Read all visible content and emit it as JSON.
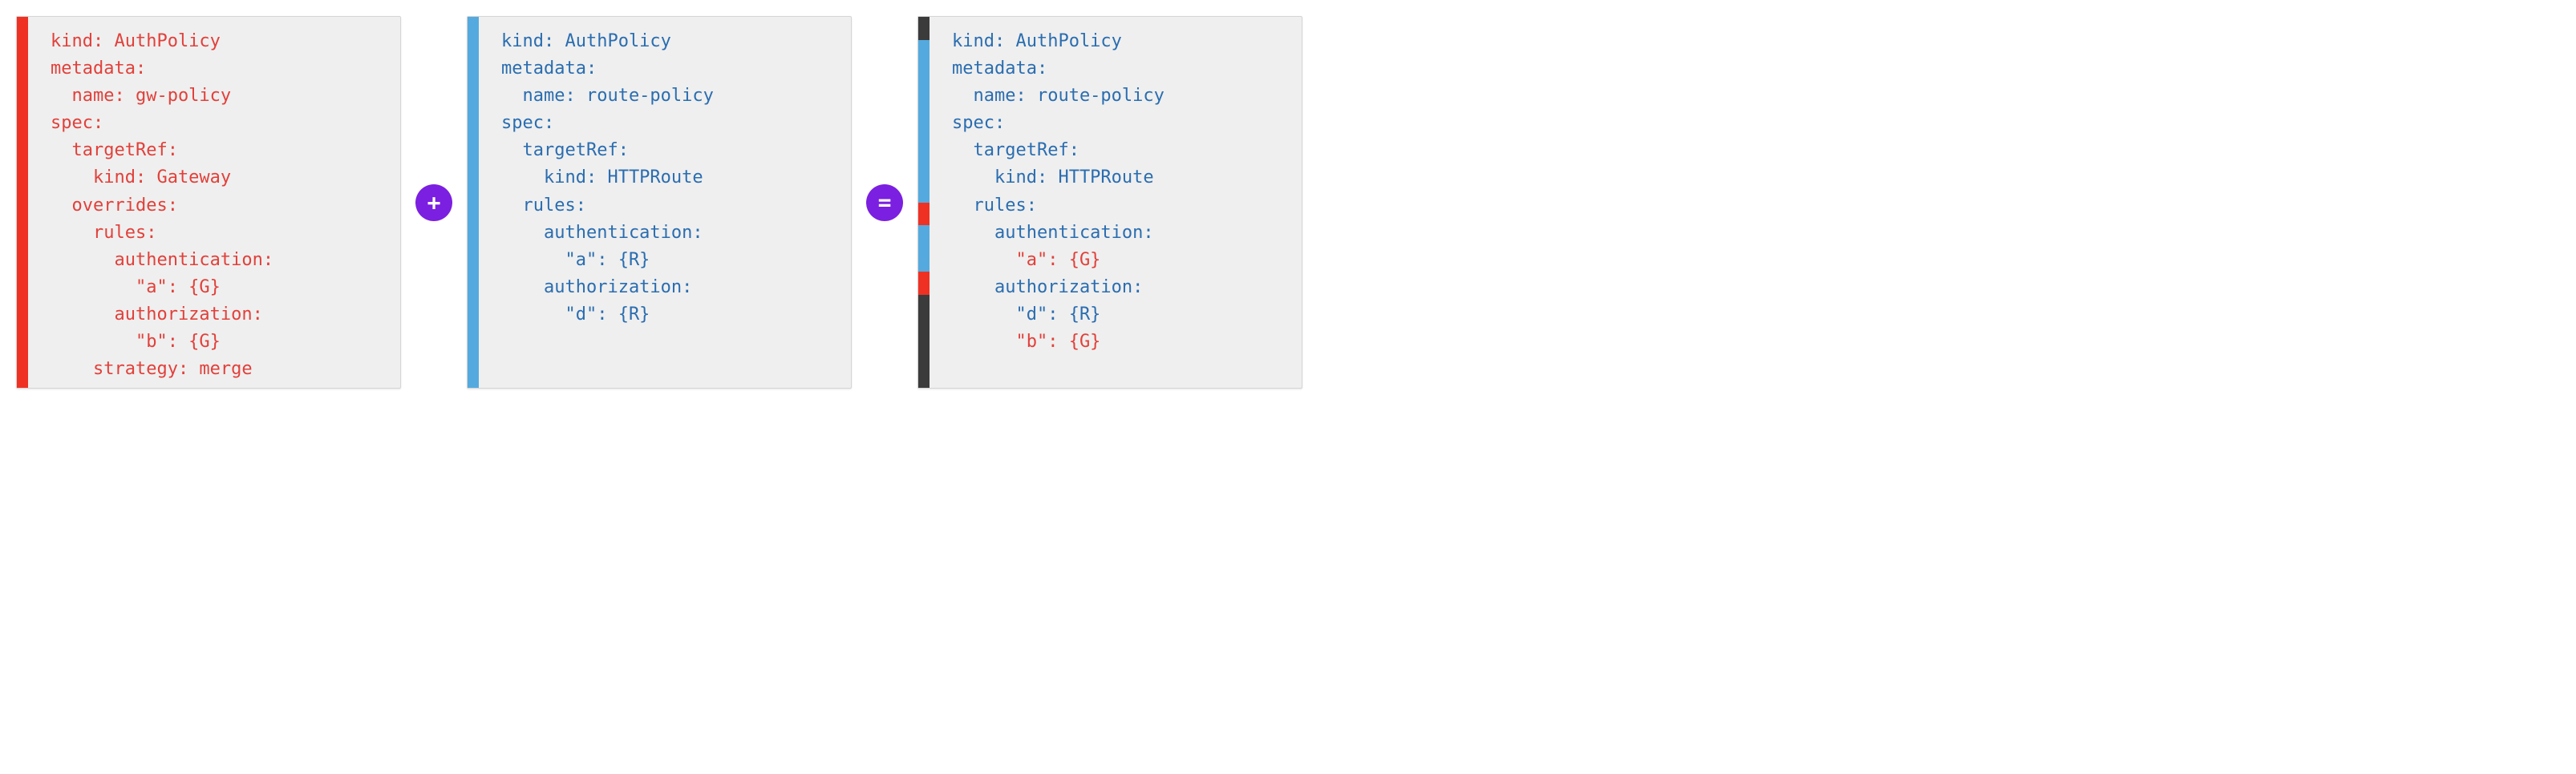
{
  "operators": {
    "plus": "+",
    "equals": "="
  },
  "panels": [
    {
      "gutter": [
        {
          "color": "#ef3123",
          "flex": 1
        }
      ],
      "lines": [
        {
          "cls": "red",
          "indent": 0,
          "text": "kind: AuthPolicy"
        },
        {
          "cls": "red",
          "indent": 0,
          "text": "metadata:"
        },
        {
          "cls": "red",
          "indent": 1,
          "text": "name: gw-policy"
        },
        {
          "cls": "red",
          "indent": 0,
          "text": "spec:"
        },
        {
          "cls": "red",
          "indent": 1,
          "text": "targetRef:"
        },
        {
          "cls": "red",
          "indent": 2,
          "text": "kind: Gateway"
        },
        {
          "cls": "red",
          "indent": 1,
          "text": "overrides:"
        },
        {
          "cls": "red",
          "indent": 2,
          "text": "rules:"
        },
        {
          "cls": "red",
          "indent": 3,
          "text": "authentication:"
        },
        {
          "cls": "red",
          "indent": 4,
          "text": "\"a\": {G}"
        },
        {
          "cls": "red",
          "indent": 3,
          "text": "authorization:"
        },
        {
          "cls": "red",
          "indent": 4,
          "text": "\"b\": {G}"
        },
        {
          "cls": "red",
          "indent": 2,
          "text": "strategy: merge"
        }
      ]
    },
    {
      "gutter": [
        {
          "color": "#54aade",
          "flex": 1
        }
      ],
      "lines": [
        {
          "cls": "blue",
          "indent": 0,
          "text": "kind: AuthPolicy"
        },
        {
          "cls": "blue",
          "indent": 0,
          "text": "metadata:"
        },
        {
          "cls": "blue",
          "indent": 1,
          "text": "name: route-policy"
        },
        {
          "cls": "blue",
          "indent": 0,
          "text": "spec:"
        },
        {
          "cls": "blue",
          "indent": 1,
          "text": "targetRef:"
        },
        {
          "cls": "blue",
          "indent": 2,
          "text": "kind: HTTPRoute"
        },
        {
          "cls": "blue",
          "indent": 1,
          "text": "rules:"
        },
        {
          "cls": "blue",
          "indent": 2,
          "text": "authentication:"
        },
        {
          "cls": "blue",
          "indent": 3,
          "text": "\"a\": {R}"
        },
        {
          "cls": "blue",
          "indent": 2,
          "text": "authorization:"
        },
        {
          "cls": "blue",
          "indent": 3,
          "text": "\"d\": {R}"
        }
      ]
    },
    {
      "gutter": [
        {
          "color": "#3b3b3b",
          "flex": 1
        },
        {
          "color": "#54aade",
          "flex": 7
        },
        {
          "color": "#ef3123",
          "flex": 1
        },
        {
          "color": "#54aade",
          "flex": 2
        },
        {
          "color": "#ef3123",
          "flex": 1
        },
        {
          "color": "#3b3b3b",
          "flex": 4
        }
      ],
      "lines": [
        {
          "cls": "blue",
          "indent": 0,
          "text": "kind: AuthPolicy"
        },
        {
          "cls": "blue",
          "indent": 0,
          "text": "metadata:"
        },
        {
          "cls": "blue",
          "indent": 1,
          "text": "name: route-policy"
        },
        {
          "cls": "blue",
          "indent": 0,
          "text": "spec:"
        },
        {
          "cls": "blue",
          "indent": 1,
          "text": "targetRef:"
        },
        {
          "cls": "blue",
          "indent": 2,
          "text": "kind: HTTPRoute"
        },
        {
          "cls": "blue",
          "indent": 1,
          "text": "rules:"
        },
        {
          "cls": "blue",
          "indent": 2,
          "text": "authentication:"
        },
        {
          "cls": "red",
          "indent": 3,
          "text": "\"a\": {G}"
        },
        {
          "cls": "blue",
          "indent": 2,
          "text": "authorization:"
        },
        {
          "cls": "blue",
          "indent": 3,
          "text": "\"d\": {R}"
        },
        {
          "cls": "red",
          "indent": 3,
          "text": "\"b\": {G}"
        }
      ]
    }
  ]
}
